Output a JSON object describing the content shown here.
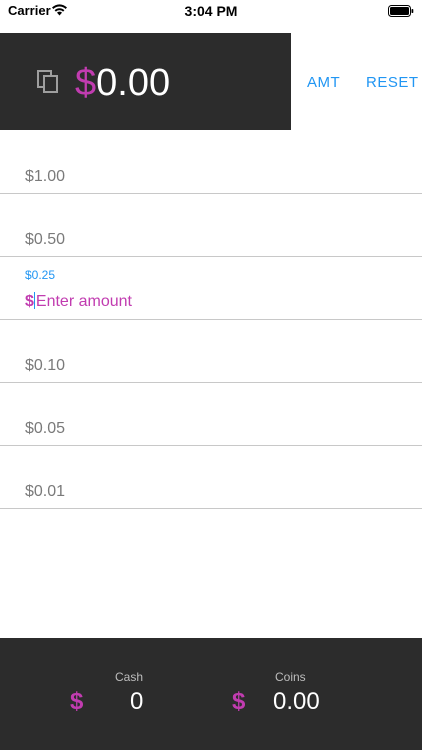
{
  "status_bar": {
    "carrier": "Carrier",
    "time": "3:04 PM"
  },
  "header": {
    "currency_symbol": "$",
    "total": "0.00",
    "amt_label": "AMT",
    "reset_label": "RESET"
  },
  "denominations": [
    {
      "label": "$1.00"
    },
    {
      "label": "$0.50"
    },
    {
      "label": "$0.25",
      "currency": "$",
      "placeholder": "Enter amount"
    },
    {
      "label": "$0.10"
    },
    {
      "label": "$0.05"
    },
    {
      "label": "$0.01"
    }
  ],
  "footer": {
    "cash_label": "Cash",
    "cash_currency": "$",
    "cash_value": "0",
    "coins_label": "Coins",
    "coins_currency": "$",
    "coins_value": "0.00"
  },
  "colors": {
    "accent": "#c13cb0",
    "link": "#2196f3",
    "panel": "#2c2c2c"
  }
}
